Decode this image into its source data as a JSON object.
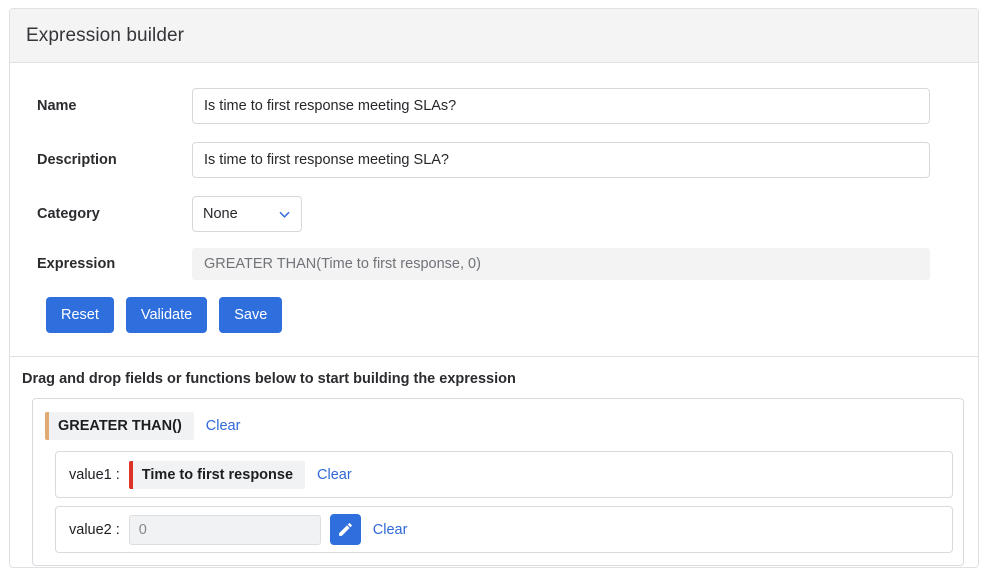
{
  "header": {
    "title": "Expression builder"
  },
  "form": {
    "name": {
      "label": "Name",
      "value": "Is time to first response meeting SLAs?"
    },
    "description": {
      "label": "Description",
      "value": "Is time to first response meeting SLA?"
    },
    "category": {
      "label": "Category",
      "selected": "None",
      "options": [
        "None"
      ]
    },
    "expression": {
      "label": "Expression",
      "value": "GREATER THAN(Time to first response, 0)"
    }
  },
  "buttons": {
    "reset": "Reset",
    "validate": "Validate",
    "save": "Save"
  },
  "builder": {
    "heading": "Drag and drop fields or functions below to start building the expression",
    "function": {
      "chip_label": "GREATER THAN()",
      "clear_label": "Clear",
      "accent_color": "#e0ab72"
    },
    "args": [
      {
        "label": "value1 :",
        "chip_label": "Time to first response",
        "accent_color": "#dd3226",
        "clear_label": "Clear",
        "type": "chip"
      },
      {
        "label": "value2 :",
        "value": "0",
        "edit_icon": "pencil-icon",
        "clear_label": "Clear",
        "type": "input"
      }
    ]
  },
  "colors": {
    "primary": "#2f6fdd",
    "link": "#3068d8",
    "header_bg": "#f4f4f4",
    "border": "#dfe1e5"
  }
}
